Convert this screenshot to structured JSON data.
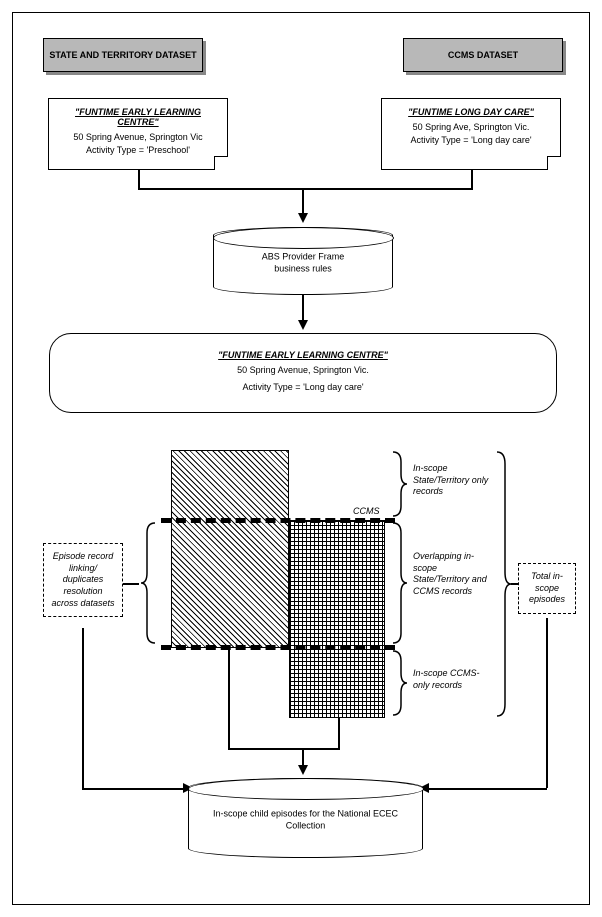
{
  "headers": {
    "state": "STATE AND TERRITORY DATASET",
    "ccms": "CCMS DATASET"
  },
  "note_left": {
    "title": "\"FUNTIME EARLY LEARNING CENTRE\"",
    "line1": "50 Spring Avenue, Springton Vic",
    "line2": "Activity Type = 'Preschool'"
  },
  "note_right": {
    "title": "\"FUNTIME LONG DAY CARE\"",
    "line1": "50 Spring Ave, Springton Vic.",
    "line2": "Activity Type = 'Long day care'"
  },
  "cylinder_abs": "ABS Provider Frame\nbusiness rules",
  "merged": {
    "title": "\"FUNTIME EARLY LEARNING CENTRE\"",
    "line1": "50 Spring Avenue, Springton Vic.",
    "line2": "Activity Type = 'Long day care'"
  },
  "ccms_label": "CCMS",
  "annot": {
    "state_only": "In-scope State/Territory only records",
    "overlap": "Overlapping in-scope State/Territory and CCMS records",
    "ccms_only": "In-scope CCMS-only records"
  },
  "left_box": "Episode record linking/ duplicates resolution across datasets",
  "right_box": "Total in-scope episodes",
  "cylinder_final": "In-scope child episodes for the National ECEC Collection"
}
